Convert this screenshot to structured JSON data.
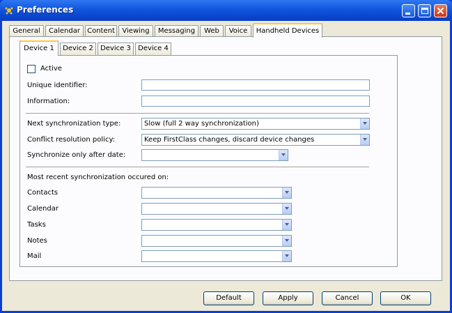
{
  "window": {
    "title": "Preferences"
  },
  "tabs": [
    "General",
    "Calendar",
    "Content",
    "Viewing",
    "Messaging",
    "Web",
    "Voice",
    "Handheld Devices"
  ],
  "active_tab": "Handheld Devices",
  "subtabs": [
    "Device 1",
    "Device 2",
    "Device 3",
    "Device 4"
  ],
  "active_subtab": "Device 1",
  "form": {
    "active_label": "Active",
    "unique_identifier_label": "Unique identifier:",
    "information_label": "Information:",
    "next_sync_type_label": "Next synchronization type:",
    "next_sync_type_value": "Slow (full 2 way synchronization)",
    "conflict_policy_label": "Conflict resolution policy:",
    "conflict_policy_value": "Keep FirstClass changes, discard device changes",
    "sync_after_date_label": "Synchronize only after date:",
    "recent_sync_label": "Most recent synchronization occured on:",
    "contacts_label": "Contacts",
    "calendar_label": "Calendar",
    "tasks_label": "Tasks",
    "notes_label": "Notes",
    "mail_label": "Mail"
  },
  "buttons": {
    "default": "Default",
    "apply": "Apply",
    "cancel": "Cancel",
    "ok": "OK"
  }
}
